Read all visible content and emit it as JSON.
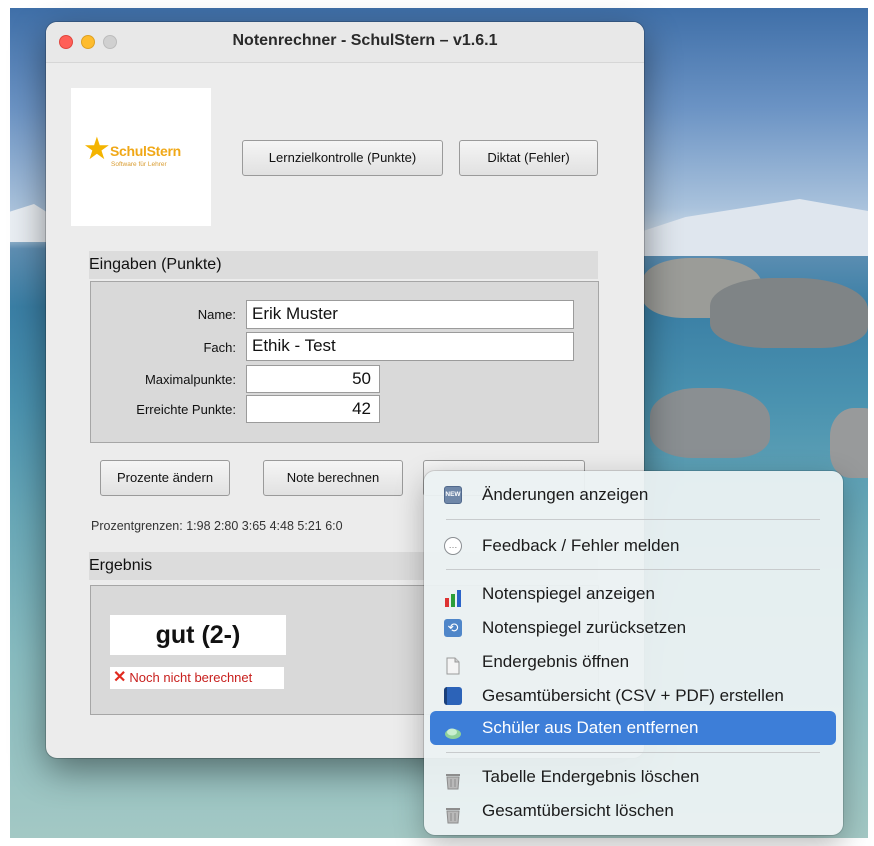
{
  "window": {
    "title": "Notenrechner - SchulStern  –  v1.6.1"
  },
  "logo": {
    "brand": "SchulStern",
    "tagline": "Software für Lehrer"
  },
  "mode_buttons": {
    "lernziel": "Lernzielkontrolle (Punkte)",
    "diktat": "Diktat (Fehler)"
  },
  "eingaben": {
    "header": "Eingaben (Punkte)",
    "name_label": "Name:",
    "name_value": "Erik Muster",
    "fach_label": "Fach:",
    "fach_value": "Ethik - Test",
    "max_label": "Maximalpunkte:",
    "max_value": "50",
    "erreicht_label": "Erreichte Punkte:",
    "erreicht_value": "42"
  },
  "actions": {
    "prozente": "Prozente ändern",
    "note": "Note berechnen"
  },
  "grenzen": "Prozentgrenzen: 1:98  2:80  3:65  4:48  5:21  6:0",
  "ergebnis": {
    "header": "Ergebnis",
    "grade": "gut (2-)",
    "status": "Noch nicht berechnet"
  },
  "menu": {
    "items": [
      {
        "label": "Änderungen anzeigen",
        "icon": "new-badge-icon"
      },
      {
        "label": "Feedback / Fehler melden",
        "icon": "speech-bubble-icon"
      },
      {
        "label": "Notenspiegel anzeigen",
        "icon": "bar-chart-icon"
      },
      {
        "label": "Notenspiegel zurücksetzen",
        "icon": "reset-arrows-icon"
      },
      {
        "label": "Endergebnis öffnen",
        "icon": "document-icon"
      },
      {
        "label": "Gesamtübersicht (CSV + PDF) erstellen",
        "icon": "book-icon"
      },
      {
        "label": "Schüler aus Daten entfernen",
        "icon": "eraser-icon"
      },
      {
        "label": "Tabelle Endergebnis löschen",
        "icon": "trash-icon"
      },
      {
        "label": "Gesamtübersicht löschen",
        "icon": "trash-icon"
      }
    ],
    "selected_index": 6,
    "new_badge_text": "NEW"
  },
  "colors": {
    "menu_highlight": "#3d7ed8",
    "warning_red": "#c8201e",
    "logo_orange": "#f0a818"
  }
}
